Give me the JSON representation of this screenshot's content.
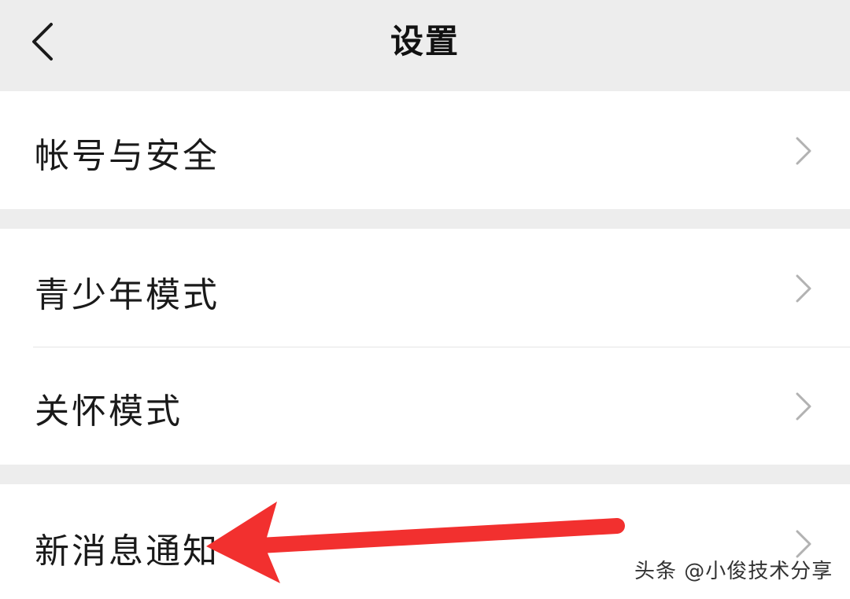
{
  "header": {
    "title": "设置",
    "back_icon": "chevron-left-icon"
  },
  "settings": {
    "account_security": "帐号与安全",
    "teen_mode": "青少年模式",
    "care_mode": "关怀模式",
    "new_message_notification": "新消息通知"
  },
  "icons": {
    "row_chevron": "chevron-right-icon"
  },
  "annotation": {
    "arrow_color": "#f2302f"
  },
  "watermark": {
    "text": "头条 @小俊技术分享"
  }
}
